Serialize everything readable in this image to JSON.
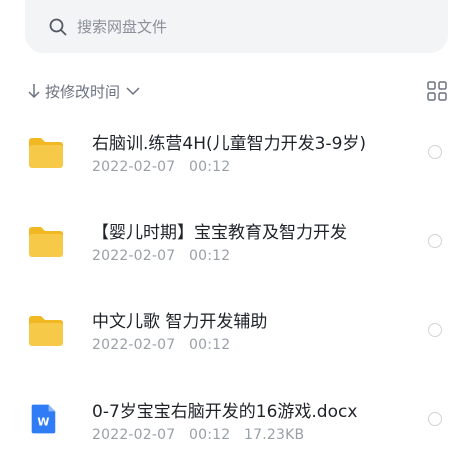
{
  "search": {
    "placeholder": "搜索网盘文件",
    "icon": "search-icon"
  },
  "sort": {
    "label": "按修改时间",
    "arrow_icon": "arrow-down-icon",
    "chevron_icon": "chevron-down-icon"
  },
  "view_toggle": {
    "icon": "grid-view-icon"
  },
  "colors": {
    "folder": "#f7c948",
    "folder_dark": "#f2b824",
    "word": "#2f7cf6",
    "text": "#1f2329",
    "meta": "#9aa0a8"
  },
  "files": [
    {
      "type": "folder",
      "icon": "folder-icon",
      "name": "右脑训.练营4H(儿童智力开发3-9岁)",
      "date": "2022-02-07",
      "time": "00:12",
      "size": ""
    },
    {
      "type": "folder",
      "icon": "folder-icon",
      "name": "【婴儿时期】宝宝教育及智力开发",
      "date": "2022-02-07",
      "time": "00:12",
      "size": ""
    },
    {
      "type": "folder",
      "icon": "folder-icon",
      "name": "中文儿歌 智力开发辅助",
      "date": "2022-02-07",
      "time": "00:12",
      "size": ""
    },
    {
      "type": "docx",
      "icon": "word-doc-icon",
      "name": "0-7岁宝宝右脑开发的16游戏.docx",
      "date": "2022-02-07",
      "time": "00:12",
      "size": "17.23KB",
      "icon_letter": "W"
    }
  ]
}
